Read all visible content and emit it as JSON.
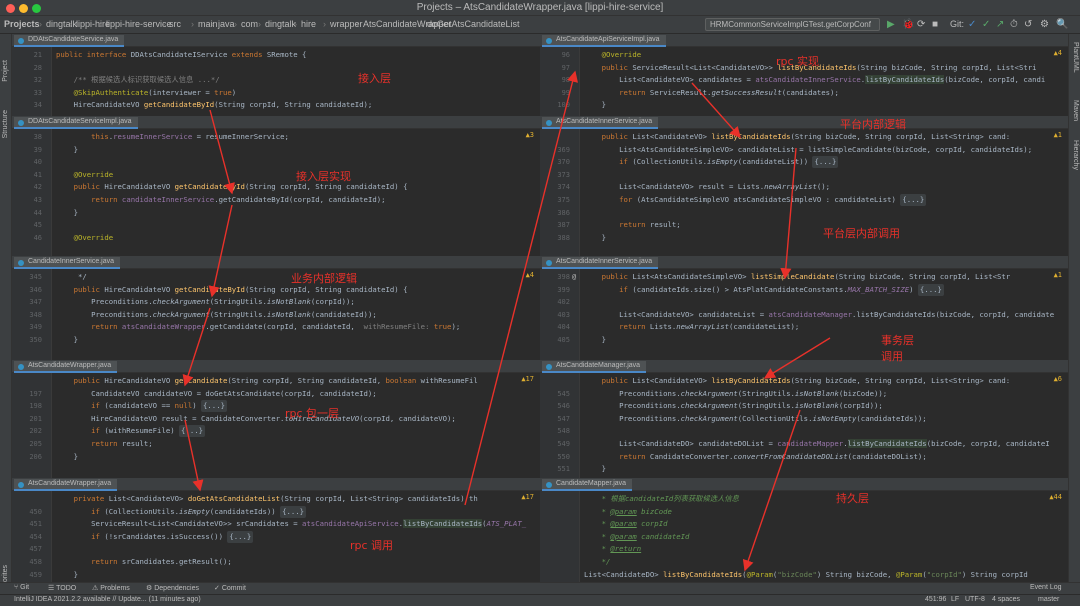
{
  "window": {
    "title": "Projects – AtsCandidateWrapper.java [lippi-hire-service]"
  },
  "breadcrumbs": [
    "Projects",
    "dingtalk",
    "lippi-hire",
    "lippi-hire-service",
    "src",
    "main",
    "java",
    "com",
    "dingtalk",
    "hire",
    "wrapper",
    "AtsCandidateWrapper",
    "doGetAtsCandidateList"
  ],
  "toolbar": {
    "run_config": "HRMCommonServiceImplGTest.getCorpConf",
    "git": "Git:"
  },
  "left_strip": [
    "Project",
    "Structure",
    "Favorites"
  ],
  "right_strip": [
    "PlantUML",
    "Maven",
    "Hierarchy"
  ],
  "panes": [
    {
      "tab": "DDAtsCandidateService.java",
      "lines": [
        {
          "n": "21",
          "g": "",
          "h": "<span class='kw'>public interface </span>DDAtsCandidateIService <span class='kw'>extends </span>SRemote {"
        },
        {
          "n": "28",
          "g": "",
          "h": ""
        },
        {
          "n": "32",
          "g": "",
          "h": "    <span class='cm'>/** 根据候选人标识获取候选人信息 ...*/</span>"
        },
        {
          "n": "33",
          "g": "",
          "h": "    <span class='an'>@SkipAuthenticate</span>(interviewer = <span class='kw'>true</span>)"
        },
        {
          "n": "34",
          "g": "",
          "h": "    HireCandidateVO <span class='fn'>getCandidateById</span>(String corpId, String candidateId);"
        }
      ]
    },
    {
      "tab": "DDAtsCandidateServiceImpl.java",
      "insp": "▲3",
      "lines": [
        {
          "n": "38",
          "g": "",
          "h": "        <span class='kw'>this</span>.<span class='fd'>resumeInnerService</span> = resumeInnerService;"
        },
        {
          "n": "39",
          "g": "",
          "h": "    }"
        },
        {
          "n": "40",
          "g": "",
          "h": ""
        },
        {
          "n": "41",
          "g": "",
          "h": "    <span class='an'>@Override</span>"
        },
        {
          "n": "42",
          "g": "",
          "h": "    <span class='kw'>public </span>HireCandidateVO <span class='fn'>getCandidateById</span>(String corpId, String candidateId) {"
        },
        {
          "n": "43",
          "g": "",
          "h": "        <span class='kw'>return </span><span class='fd'>candidateInnerService</span>.getCandidateById(corpId, candidateId);"
        },
        {
          "n": "44",
          "g": "",
          "h": "    }"
        },
        {
          "n": "45",
          "g": "",
          "h": ""
        },
        {
          "n": "46",
          "g": "",
          "h": "    <span class='an'>@Override</span>"
        }
      ]
    },
    {
      "tab": "CandidateInnerService.java",
      "insp": "▲4",
      "lines": [
        {
          "n": "345",
          "g": "",
          "h": "     */"
        },
        {
          "n": "346",
          "g": "",
          "h": "    <span class='kw'>public </span>HireCandidateVO <span class='fn'>getCandidateById</span>(String corpId, String candidateId) {"
        },
        {
          "n": "347",
          "g": "",
          "h": "        Preconditions.<span class='it'>checkArgument</span>(StringUtils.<span class='it'>isNotBlank</span>(corpId));"
        },
        {
          "n": "348",
          "g": "",
          "h": "        Preconditions.<span class='it'>checkArgument</span>(StringUtils.<span class='it'>isNotBlank</span>(candidateId));"
        },
        {
          "n": "349",
          "g": "",
          "h": "        <span class='kw'>return </span><span class='fd'>atsCandidateWrapper</span>.getCandidate(corpId, candidateId,  <span class='cm'>withResumeFile: </span><span class='kw'>true</span>);"
        },
        {
          "n": "350",
          "g": "",
          "h": "    }"
        }
      ]
    },
    {
      "tab": "AtsCandidateWrapper.java",
      "insp": "▲17",
      "lines": [
        {
          "n": "",
          "g": "",
          "h": "    <span class='kw'>public </span>HireCandidateVO <span class='fn'>getCandidate</span>(String corpId, String candidateId, <span class='kw'>boolean </span>withResumeFil"
        },
        {
          "n": "197",
          "g": "",
          "h": "        CandidateVO candidateVO = doGetAtsCandidate(corpId, candidateId);"
        },
        {
          "n": "198",
          "g": "",
          "h": "        <span class='kw'>if </span>(candidateVO == <span class='kw'>null</span>) <span class='fold'>{...}</span>"
        },
        {
          "n": "201",
          "g": "",
          "h": "        HireCandidateVO result = CandidateConverter.<span class='it'>toHireCandidateVO</span>(corpId, candidateVO);"
        },
        {
          "n": "202",
          "g": "",
          "h": "        <span class='kw'>if </span>(withResumeFile) <span class='fold'>{...}</span>"
        },
        {
          "n": "205",
          "g": "",
          "h": "        <span class='kw'>return </span>result;"
        },
        {
          "n": "206",
          "g": "",
          "h": "    }"
        }
      ]
    },
    {
      "tab": "AtsCandidateWrapper.java",
      "insp": "▲17",
      "lines": [
        {
          "n": "",
          "g": "",
          "h": "    <span class='kw'>private </span>List&lt;CandidateVO&gt; <span class='fn'>doGetAtsCandidateList</span>(String corpId, List&lt;String&gt; candidateIds) th"
        },
        {
          "n": "450",
          "g": "",
          "h": "        <span class='kw'>if </span>(CollectionUtils.<span class='it'>isEmpty</span>(candidateIds)) <span class='fold'>{...}</span>"
        },
        {
          "n": "451",
          "g": "",
          "h": "        ServiceResult&lt;List&lt;CandidateVO&gt;&gt; srCandidates = <span class='fd'>atsCandidateApiService</span>.<span class='hl'>listByCandidateIds</span>(<span class='sm'>ATS_PLAT_</span>"
        },
        {
          "n": "454",
          "g": "",
          "h": "        <span class='kw'>if </span>(!srCandidates.isSuccess()) <span class='fold'>{...}</span>"
        },
        {
          "n": "457",
          "g": "",
          "h": ""
        },
        {
          "n": "458",
          "g": "",
          "h": "        <span class='kw'>return </span>srCandidates.getResult();"
        },
        {
          "n": "459",
          "g": "",
          "h": "    }"
        }
      ]
    },
    {
      "tab": "AtsCandidateApiServiceImpl.java",
      "insp": "▲4",
      "lines": [
        {
          "n": "96",
          "g": "",
          "h": "    <span class='an'>@Override</span>"
        },
        {
          "n": "97",
          "g": "",
          "h": "    <span class='kw'>public </span>ServiceResult&lt;List&lt;CandidateVO&gt;&gt; <span class='fn'>listByCandidateIds</span>(String bizCode, String corpId, List&lt;Stri"
        },
        {
          "n": "98",
          "g": "",
          "h": "        List&lt;CandidateVO&gt; candidates = <span class='fd'>atsCandidateInnerService</span>.<span class='hl'>listByCandidateIds</span>(bizCode, corpId, candi"
        },
        {
          "n": "99",
          "g": "",
          "h": "        <span class='kw'>return </span>ServiceResult.<span class='it'>getSuccessResult</span>(candidates);"
        },
        {
          "n": "100",
          "g": "",
          "h": "    }"
        }
      ]
    },
    {
      "tab": "AtsCandidateInnerService.java",
      "insp": "▲1",
      "lines": [
        {
          "n": "",
          "g": "",
          "h": "    <span class='kw'>public </span>List&lt;CandidateVO&gt; <span class='fn'>listByCandidateIds</span>(String bizCode, String corpId, List&lt;String&gt; cand:"
        },
        {
          "n": "369",
          "g": "",
          "h": "        List&lt;AtsCandidateSimpleVO&gt; candidateList = listSimpleCandidate(bizCode, corpId, candidateIds);"
        },
        {
          "n": "370",
          "g": "",
          "h": "        <span class='kw'>if </span>(CollectionUtils.<span class='it'>isEmpty</span>(candidateList)) <span class='fold'>{...}</span>"
        },
        {
          "n": "373",
          "g": "",
          "h": ""
        },
        {
          "n": "374",
          "g": "",
          "h": "        List&lt;CandidateVO&gt; result = Lists.<span class='it'>newArrayList</span>();"
        },
        {
          "n": "375",
          "g": "",
          "h": "        <span class='kw'>for </span>(AtsCandidateSimpleVO atsCandidateSimpleVO : candidateList) <span class='fold'>{...}</span>"
        },
        {
          "n": "386",
          "g": "",
          "h": ""
        },
        {
          "n": "387",
          "g": "",
          "h": "        <span class='kw'>return </span>result;"
        },
        {
          "n": "388",
          "g": "",
          "h": "    }"
        }
      ]
    },
    {
      "tab": "AtsCandidateInnerService.java",
      "insp": "▲1",
      "lines": [
        {
          "n": "398",
          "g": "@",
          "h": "    <span class='kw'>public </span>List&lt;AtsCandidateSimpleVO&gt; <span class='fn'>listSimpleCandidate</span>(String bizCode, String corpId, List&lt;Str"
        },
        {
          "n": "399",
          "g": "",
          "h": "        <span class='kw'>if </span>(candidateIds.size() &gt; AtsPlatCandidateConstants.<span class='sm'>MAX_BATCH_SIZE</span>) <span class='fold'>{...}</span>"
        },
        {
          "n": "402",
          "g": "",
          "h": ""
        },
        {
          "n": "403",
          "g": "",
          "h": "        List&lt;CandidateVO&gt; candidateList = <span class='fd'>atsCandidateManager</span>.listByCandidateIds(bizCode, corpId, candidate"
        },
        {
          "n": "404",
          "g": "",
          "h": "        <span class='kw'>return </span>Lists.<span class='it'>newArrayList</span>(candidateList);"
        },
        {
          "n": "405",
          "g": "",
          "h": "    }"
        }
      ]
    },
    {
      "tab": "AtsCandidateManager.java",
      "insp": "▲6",
      "lines": [
        {
          "n": "",
          "g": "",
          "h": "    <span class='kw'>public </span>List&lt;CandidateVO&gt; <span class='fn'>listByCandidateIds</span>(String bizCode, String corpId, List&lt;String&gt; cand:"
        },
        {
          "n": "545",
          "g": "",
          "h": "        Preconditions.<span class='it'>checkArgument</span>(StringUtils.<span class='it'>isNotBlank</span>(bizCode));"
        },
        {
          "n": "546",
          "g": "",
          "h": "        Preconditions.<span class='it'>checkArgument</span>(StringUtils.<span class='it'>isNotBlank</span>(corpId));"
        },
        {
          "n": "547",
          "g": "",
          "h": "        Preconditions.<span class='it'>checkArgument</span>(CollectionUtils.<span class='it'>isNotEmpty</span>(candidateIds));"
        },
        {
          "n": "548",
          "g": "",
          "h": ""
        },
        {
          "n": "549",
          "g": "",
          "h": "        List&lt;CandidateDO&gt; candidateDOList = <span class='fd'>candidateMapper</span>.<span class='hl'>listByCandidateIds</span>(bizCode, corpId, candidateI"
        },
        {
          "n": "550",
          "g": "",
          "h": "        <span class='kw'>return </span>CandidateConverter.<span class='it'>convertFromCandidateDOList</span>(candidateDOList);"
        },
        {
          "n": "551",
          "g": "",
          "h": "    }"
        }
      ]
    },
    {
      "tab": "CandidateMapper.java",
      "insp": "▲44",
      "lines": [
        {
          "n": "",
          "g": "",
          "h": "    <span class='dc'>* 根据candidateId列表获取候选人信息</span>"
        },
        {
          "n": "",
          "g": "",
          "h": "    <span class='dc'>* </span><span class='dc' style='text-decoration:underline'>@param</span><span class='dc'> bizCode</span>"
        },
        {
          "n": "",
          "g": "",
          "h": "    <span class='dc'>* </span><span class='dc' style='text-decoration:underline'>@param</span><span class='dc'> corpId</span>"
        },
        {
          "n": "",
          "g": "",
          "h": "    <span class='dc'>* </span><span class='dc' style='text-decoration:underline'>@param</span><span class='dc'> candidateId</span>"
        },
        {
          "n": "",
          "g": "",
          "h": "    <span class='dc'>* </span><span class='dc' style='text-decoration:underline'>@return</span>"
        },
        {
          "n": "",
          "g": "",
          "h": "    <span class='dc'>*/</span>"
        },
        {
          "n": "",
          "g": "",
          "h": "List&lt;CandidateDO&gt; <span class='fn'>listByCandidateIds</span>(<span class='an'>@Param</span>(<span class='st'>\"bizCode\"</span>) String bizCode, <span class='an'>@Param</span>(<span class='st'>\"corpId\"</span>) String corpId"
        }
      ]
    }
  ],
  "annotations": [
    {
      "text": "接入层"
    },
    {
      "text": "接入层实现"
    },
    {
      "text": "业务内部逻辑"
    },
    {
      "text": "rpc 包一层"
    },
    {
      "text": "rpc 调用"
    },
    {
      "text": "rpc 实现"
    },
    {
      "text": "平台内部逻辑"
    },
    {
      "text": "平台层内部调用"
    },
    {
      "text": "事务层\n调用"
    },
    {
      "text": "持久层"
    }
  ],
  "bottom_tools": [
    "Git",
    "TODO",
    "Problems",
    "Dependencies",
    "Commit"
  ],
  "event_log": "Event Log",
  "status": {
    "message": "IntelliJ IDEA 2021.2.2 available // Update... (11 minutes ago)",
    "position": "451:96",
    "line_sep": "LF",
    "encoding": "UTF-8",
    "indent": "4 spaces",
    "branch": "master"
  },
  "colors": {
    "annotation": "#e8312a",
    "arrow": "#e8312a",
    "accent": "#4a88c7"
  }
}
